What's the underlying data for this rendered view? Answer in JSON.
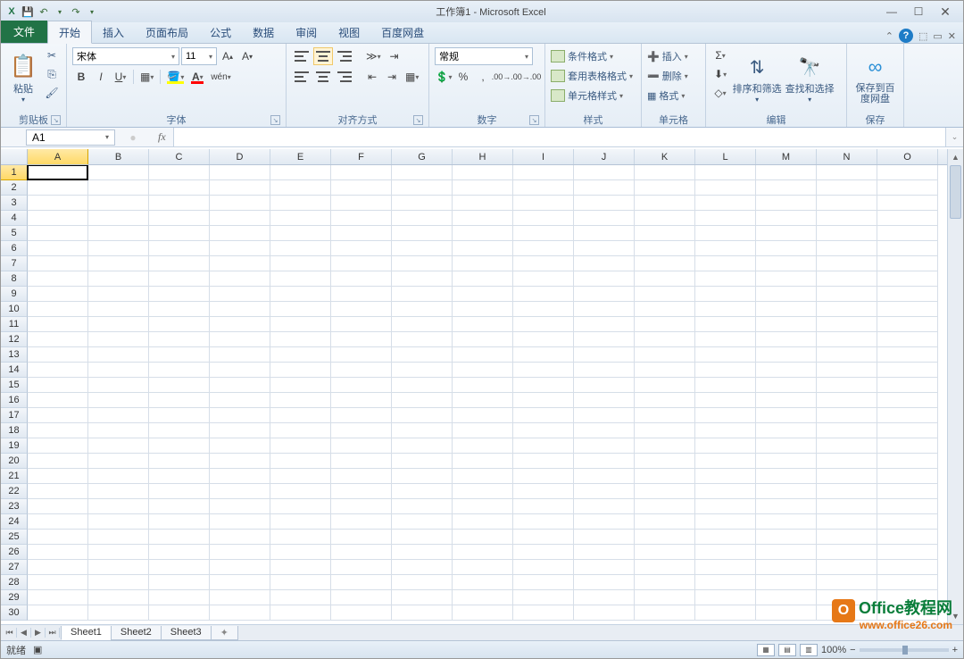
{
  "title": "工作簿1 - Microsoft Excel",
  "qat": {
    "save": "💾",
    "undo": "↶",
    "redo": "↷"
  },
  "tabs": {
    "file": "文件",
    "items": [
      "开始",
      "插入",
      "页面布局",
      "公式",
      "数据",
      "审阅",
      "视图",
      "百度网盘"
    ]
  },
  "ribbon": {
    "clipboard": {
      "label": "剪贴板",
      "paste": "粘贴"
    },
    "font": {
      "label": "字体",
      "name": "宋体",
      "size": "11"
    },
    "align": {
      "label": "对齐方式"
    },
    "number": {
      "label": "数字",
      "format": "常规"
    },
    "styles": {
      "label": "样式",
      "cond": "条件格式",
      "table": "套用表格格式",
      "cell": "单元格样式"
    },
    "cells": {
      "label": "单元格",
      "insert": "插入",
      "delete": "删除",
      "format": "格式"
    },
    "editing": {
      "label": "编辑",
      "sort": "排序和筛选",
      "find": "查找和选择"
    },
    "save": {
      "label": "保存",
      "baidu": "保存到百度网盘"
    }
  },
  "formula": {
    "cell": "A1",
    "fx": "fx",
    "value": ""
  },
  "grid": {
    "cols": [
      "A",
      "B",
      "C",
      "D",
      "E",
      "F",
      "G",
      "H",
      "I",
      "J",
      "K",
      "L",
      "M",
      "N",
      "O"
    ],
    "rows": 30,
    "active": {
      "row": 1,
      "col": "A"
    }
  },
  "sheets": {
    "items": [
      "Sheet1",
      "Sheet2",
      "Sheet3"
    ],
    "active": 0
  },
  "status": {
    "ready": "就绪",
    "zoom": "100%"
  },
  "watermark": {
    "line1a": "Office",
    "line1b": "教程网",
    "line2": "www.office26.com",
    "badge": "O"
  }
}
